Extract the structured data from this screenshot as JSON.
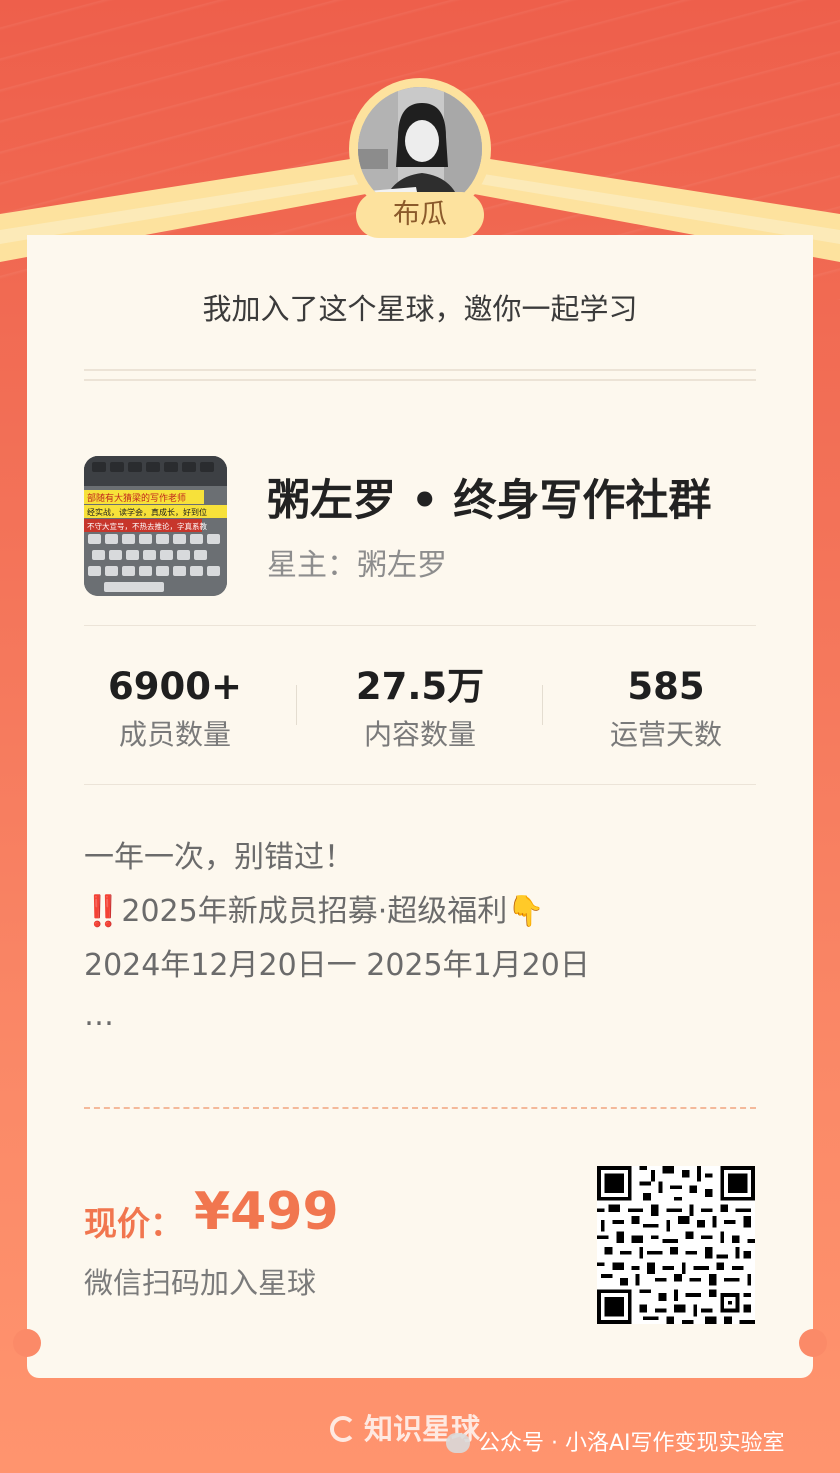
{
  "header": {
    "user_name": "布瓜",
    "invite_text": "我加入了这个星球，邀你一起学习"
  },
  "group": {
    "title": "粥左罗 • 终身写作社群",
    "owner": "星主：粥左罗",
    "cover_lines": [
      "部随有大猜梁的写作老师",
      "经实战，读学会，真成长，好到位",
      "不守大宣号，不热去推论，字真系教"
    ]
  },
  "stats": [
    {
      "value": "6900+",
      "label": "成员数量"
    },
    {
      "value": "27.5万",
      "label": "内容数量"
    },
    {
      "value": "585",
      "label": "运营天数"
    }
  ],
  "description": {
    "line1": "一年一次，别错过！",
    "line2_icon": "‼️",
    "line2": "2025年新成员招募·超级福利",
    "line2_end_icon": "👇",
    "line3": "2024年12月20日一 2025年1月20日",
    "line4": "…"
  },
  "purchase": {
    "price_label": "现价：",
    "price": "¥499",
    "scan_text": "微信扫码加入星球"
  },
  "footer": {
    "brand": "知识星球",
    "watermark": "公众号 · 小洛AI写作变现实验室"
  },
  "colors": {
    "accent": "#f1764f",
    "gold": "#fde29e",
    "card": "#fdf8ee",
    "background_top": "#ee5f4b",
    "background_bottom": "#ff946e"
  }
}
